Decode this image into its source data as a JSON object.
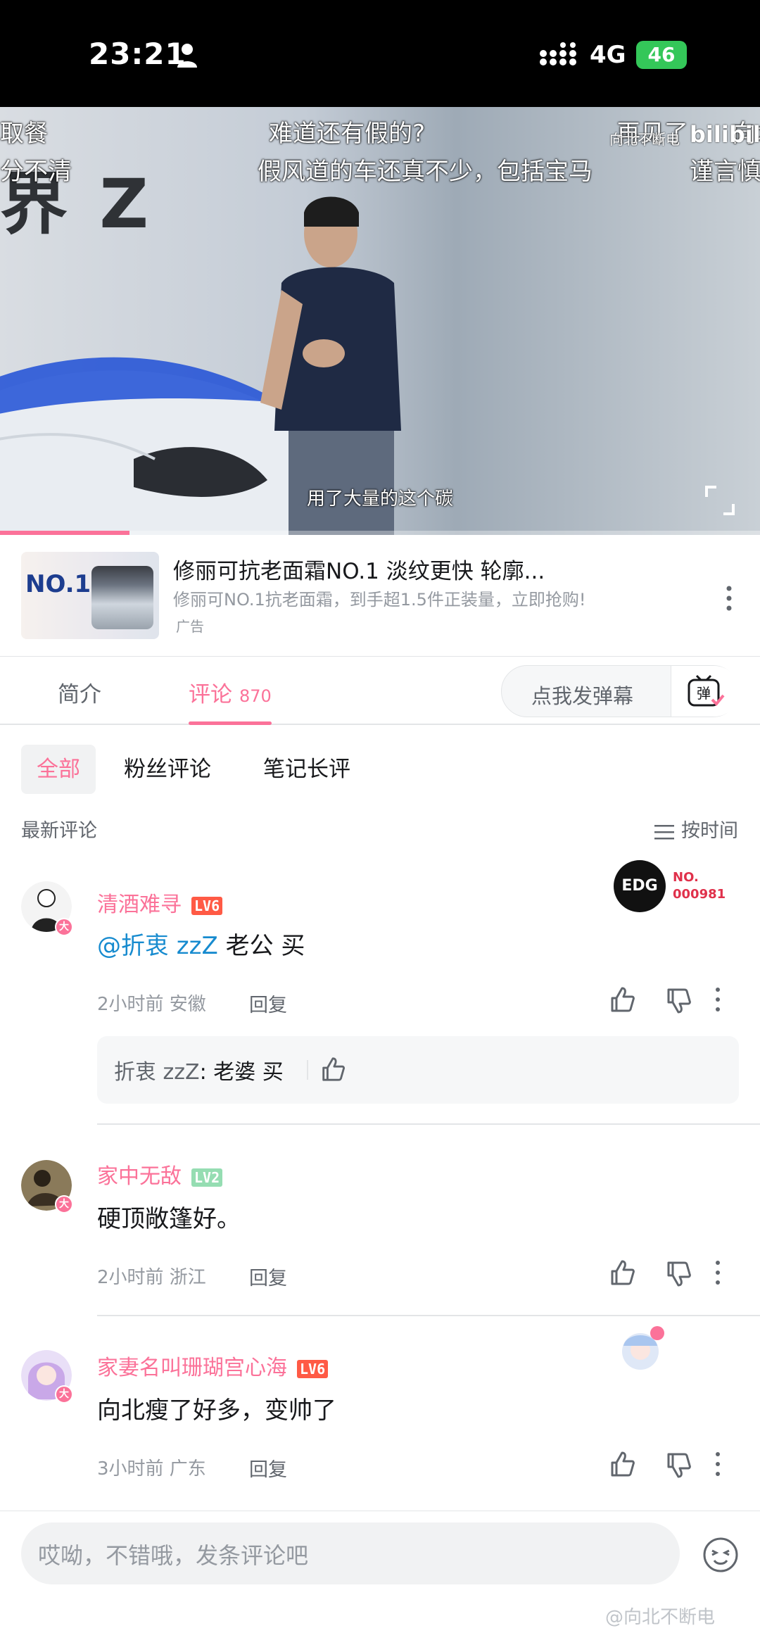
{
  "status_bar": {
    "time": "23:21",
    "network": "4G",
    "battery": "46"
  },
  "video": {
    "danmaku": [
      "取餐",
      "难道还有假的?",
      "再见了",
      "向北",
      "分不清",
      "假风道的车还真不少，包括宝马",
      "谨言慎"
    ],
    "watermark": "向北不断电",
    "platform": "bilibili",
    "subtitle": "用了大量的这个碳",
    "progress": 0.17
  },
  "ad": {
    "thumb_text": "NO.1",
    "title": "修丽可抗老面霜NO.1 淡纹更快 轮廓...",
    "description": "修丽可NO.1抗老面霜，到手超1.5件正装量，立即抢购!",
    "tag": "广告"
  },
  "tabs": {
    "intro": "简介",
    "comments": "评论",
    "comments_count": "870",
    "danmaku_placeholder": "点我发弹幕",
    "danmaku_icon": "弹"
  },
  "filters": {
    "all": "全部",
    "fans": "粉丝评论",
    "notes": "笔记长评"
  },
  "sort": {
    "title": "最新评论",
    "button": "按时间"
  },
  "comments": [
    {
      "user": "清酒难寻",
      "level": "LV6",
      "avatar_badge": "大",
      "mention": "@折衷 zzZ",
      "text": " 老公 买",
      "time_location": "2小时前 安徽",
      "reply": "回复",
      "badge_text": "EDG",
      "badge_no": "NO.",
      "badge_num": "000981",
      "sub_reply": {
        "name": "折衷 zzZ",
        "text": ": 老婆 买"
      }
    },
    {
      "user": "家中无敌",
      "level": "LV2",
      "avatar_badge": "大",
      "text": "硬顶敞篷好。",
      "time_location": "2小时前 浙江",
      "reply": "回复"
    },
    {
      "user": "家妻名叫珊瑚宫心海",
      "level": "LV6",
      "avatar_badge": "大",
      "text": "向北瘦了好多，变帅了",
      "time_location": "3小时前 广东",
      "reply": "回复"
    }
  ],
  "bottom": {
    "input_placeholder": "哎呦，不错哦，发条评论吧",
    "weibo_mark": "@向北不断电"
  },
  "colors": {
    "accent": "#fb7299",
    "mention": "#178bcf",
    "lv6": "#ff5a45",
    "lv2": "#95ddb2"
  }
}
